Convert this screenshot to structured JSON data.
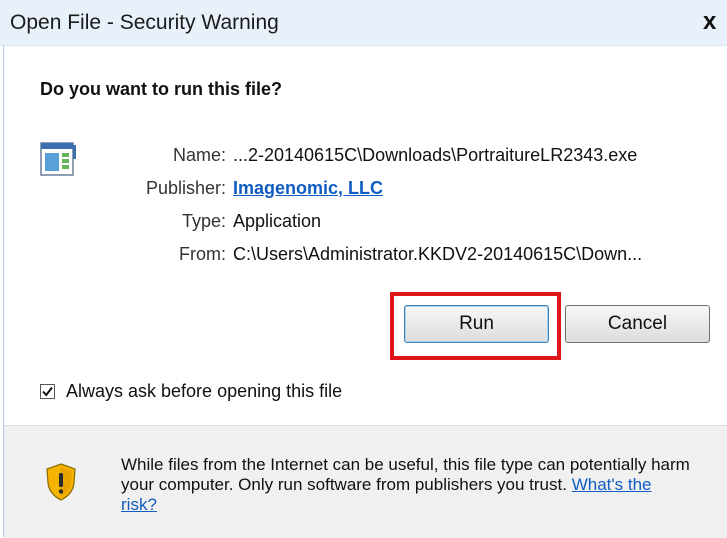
{
  "window": {
    "title": "Open File - Security Warning",
    "close_glyph": "x"
  },
  "dialog": {
    "heading": "Do you want to run this file?",
    "file_icon": "executable-file-icon",
    "fields": {
      "name_label": "Name:",
      "name_value": "...2-20140615C\\Downloads\\PortraitureLR2343.exe",
      "publisher_label": "Publisher:",
      "publisher_value": "Imagenomic, LLC",
      "type_label": "Type:",
      "type_value": "Application",
      "from_label": "From:",
      "from_value": "C:\\Users\\Administrator.KKDV2-20140615C\\Down..."
    },
    "buttons": {
      "run_label": "Run",
      "cancel_label": "Cancel"
    },
    "checkbox": {
      "label": "Always ask before opening this file",
      "checked": true
    },
    "warning": {
      "icon": "shield-warning-icon",
      "text": "While files from the Internet can be useful, this file type can potentially harm your computer. Only run software from publishers you trust.",
      "link_text": "What's the risk?"
    }
  },
  "colors": {
    "highlight": "#e0141b",
    "link": "#0f5cc2",
    "titlebar": "#e8f1fa"
  }
}
